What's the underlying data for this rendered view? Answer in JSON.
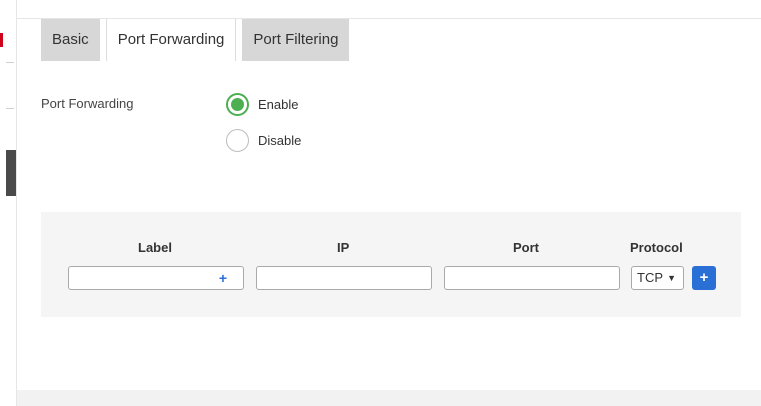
{
  "tabs": [
    {
      "label": "Basic",
      "active": false
    },
    {
      "label": "Port Forwarding",
      "active": true
    },
    {
      "label": "Port Filtering",
      "active": false
    }
  ],
  "port_forwarding": {
    "label": "Port Forwarding",
    "options": [
      {
        "label": "Enable",
        "selected": true
      },
      {
        "label": "Disable",
        "selected": false
      }
    ]
  },
  "rules_table": {
    "columns": [
      "Label",
      "IP",
      "Port",
      "Protocol"
    ],
    "inputs": {
      "label": {
        "value": "",
        "placeholder": ""
      },
      "ip": {
        "value": "",
        "placeholder": ""
      },
      "port": {
        "value": "",
        "placeholder": ""
      }
    },
    "label_add_glyph": "+",
    "protocol": {
      "selected": "TCP",
      "arrow": "▼"
    },
    "add_button_label": "+"
  },
  "colors": {
    "accent": "#2a6fd6",
    "radio_selected": "#4caf50",
    "tab_inactive": "#d7d7d7",
    "panel_bg": "#f5f5f5"
  }
}
